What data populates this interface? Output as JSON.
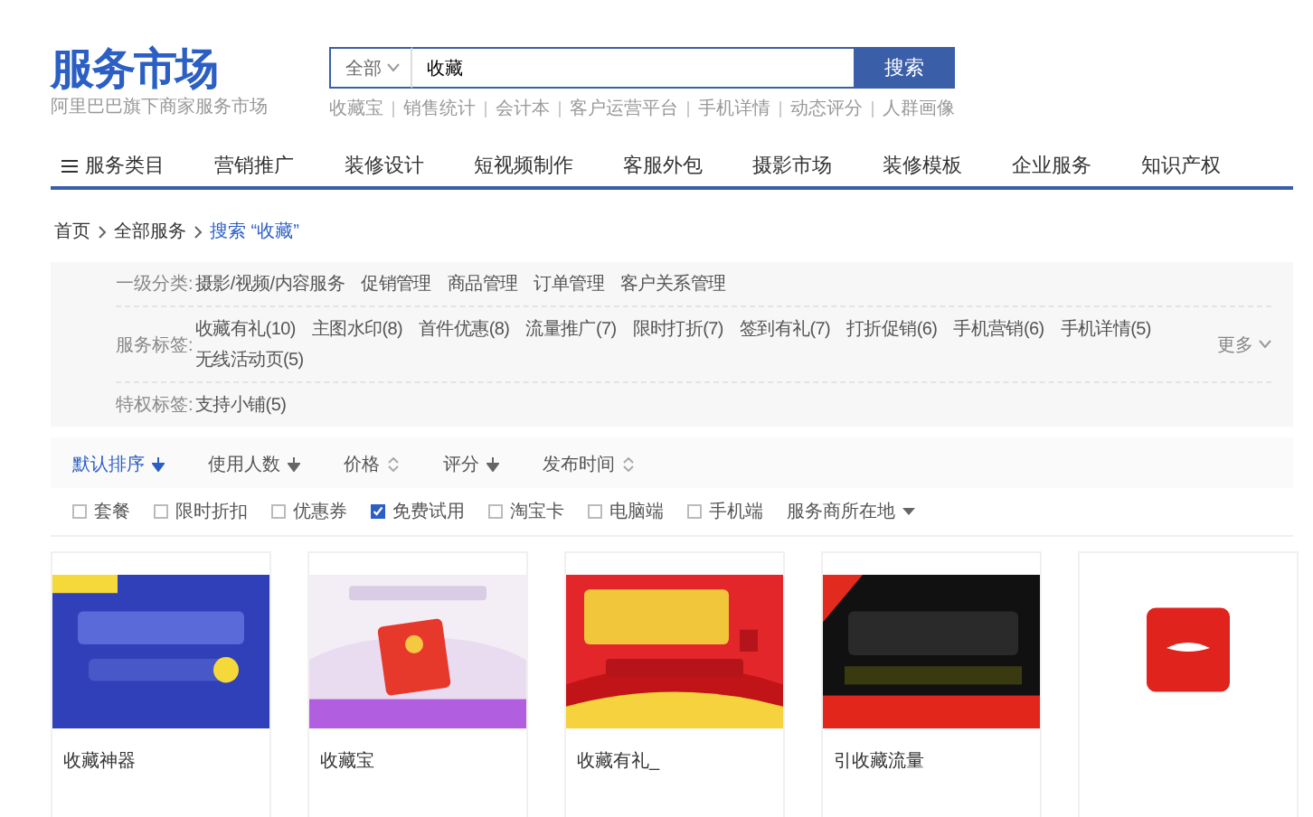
{
  "logo": {
    "title": "服务市场",
    "subtitle": "阿里巴巴旗下商家服务市场"
  },
  "search": {
    "scope": "全部",
    "value": "收藏",
    "button": "搜索"
  },
  "hot_links": [
    "收藏宝",
    "销售统计",
    "会计本",
    "客户运营平台",
    "手机详情",
    "动态评分",
    "人群画像"
  ],
  "nav": [
    {
      "label": "服务类目",
      "kind": "menu"
    },
    {
      "label": "营销推广",
      "kind": "link"
    },
    {
      "label": "装修设计",
      "kind": "link"
    },
    {
      "label": "短视频制作",
      "kind": "link"
    },
    {
      "label": "客服外包",
      "kind": "link"
    },
    {
      "label": "摄影市场",
      "kind": "link"
    },
    {
      "label": "装修模板",
      "kind": "link"
    },
    {
      "label": "企业服务",
      "kind": "link"
    },
    {
      "label": "知识产权",
      "kind": "link"
    }
  ],
  "breadcrumb": [
    "首页",
    "全部服务",
    "搜索 “收藏”"
  ],
  "filters": [
    {
      "label": "一级分类:",
      "items": [
        "摄影/视频/内容服务",
        "促销管理",
        "商品管理",
        "订单管理",
        "客户关系管理"
      ]
    },
    {
      "label": "服务标签:",
      "items": [
        "收藏有礼(10)",
        "主图水印(8)",
        "首件优惠(8)",
        "流量推广(7)",
        "限时打折(7)",
        "签到有礼(7)",
        "打折促销(6)",
        "手机营销(6)",
        "手机详情(5)",
        "无线活动页(5)"
      ],
      "more": "更多"
    },
    {
      "label": "特权标签:",
      "items": [
        "支持小铺(5)"
      ]
    }
  ],
  "sort": [
    {
      "label": "默认排序",
      "selected": true,
      "kind": "down"
    },
    {
      "label": "使用人数",
      "selected": false,
      "kind": "down"
    },
    {
      "label": "价格",
      "selected": false,
      "kind": "both"
    },
    {
      "label": "评分",
      "selected": false,
      "kind": "down"
    },
    {
      "label": "发布时间",
      "selected": false,
      "kind": "both"
    }
  ],
  "options": [
    {
      "label": "套餐",
      "checked": false
    },
    {
      "label": "限时折扣",
      "checked": false
    },
    {
      "label": "优惠券",
      "checked": false
    },
    {
      "label": "免费试用",
      "checked": true
    },
    {
      "label": "淘宝卡",
      "checked": false
    },
    {
      "label": "电脑端",
      "checked": false
    },
    {
      "label": "手机端",
      "checked": false
    }
  ],
  "location": "服务商所在地",
  "cards": [
    {
      "title": "收藏神器",
      "kind": "picture"
    },
    {
      "title": "收藏宝",
      "kind": "picture"
    },
    {
      "title": "收藏有礼_",
      "kind": "picture"
    },
    {
      "title": "引收藏流量",
      "kind": "picture"
    },
    {
      "kind": "picture"
    }
  ]
}
